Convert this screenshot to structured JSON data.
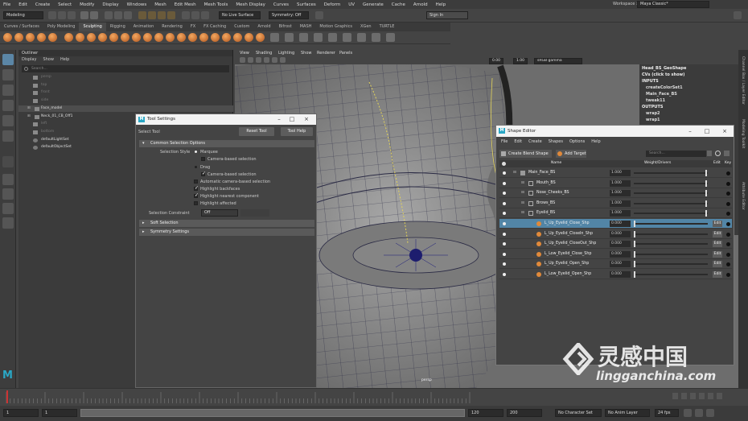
{
  "menubar": {
    "items": [
      "File",
      "Edit",
      "Create",
      "Select",
      "Modify",
      "Display",
      "Windows",
      "Mesh",
      "Edit Mesh",
      "Mesh Tools",
      "Mesh Display",
      "Curves",
      "Surfaces",
      "Deform",
      "UV",
      "Generate",
      "Cache",
      "Arnold",
      "Help"
    ],
    "workspace_label": "Workspace :",
    "workspace_value": "Maya Classic*"
  },
  "statusline": {
    "mode": "Modeling",
    "live_surface": "No Live Surface",
    "symmetry": "Symmetry: Off",
    "sign_in": "Sign In"
  },
  "shelf": {
    "tabs": [
      "Curves / Surfaces",
      "Poly Modeling",
      "Sculpting",
      "Rigging",
      "Animation",
      "Rendering",
      "FX",
      "FX Caching",
      "Custom",
      "Arnold",
      "Bifrost",
      "MASH",
      "Motion Graphics",
      "XGen",
      "TURTLE"
    ],
    "active_tab": "Sculpting"
  },
  "outliner": {
    "title": "Outliner",
    "menu": [
      "Display",
      "Show",
      "Help"
    ],
    "search_placeholder": "Search...",
    "items": [
      {
        "label": "persp",
        "dim": true
      },
      {
        "label": "top",
        "dim": true
      },
      {
        "label": "front",
        "dim": true
      },
      {
        "label": "side",
        "dim": true
      },
      {
        "label": "Face_model",
        "dim": false,
        "selected": true
      },
      {
        "label": "Neck_01_CB_Off1",
        "dim": false
      },
      {
        "label": "left",
        "dim": true
      },
      {
        "label": "bottom",
        "dim": true
      },
      {
        "label": "defaultLightSet",
        "dim": false
      },
      {
        "label": "defaultObjectSet",
        "dim": false
      }
    ]
  },
  "viewport": {
    "menu": [
      "View",
      "Shading",
      "Lighting",
      "Show",
      "Renderer",
      "Panels"
    ],
    "exposure": "0.00",
    "gamma": "1.00",
    "colorspace": "sRGB gamma",
    "camera_label": "persp"
  },
  "channelbox": {
    "menu": [
      "Channels",
      "Edit",
      "Object",
      "Show"
    ],
    "node": "Head_BS_GeoShape",
    "cvs": "CVs (click to show)",
    "inputs_label": "INPUTS",
    "inputs": [
      "createColorSet1",
      "Main_Face_BS",
      "tweak11"
    ],
    "outputs_label": "OUTPUTS",
    "outputs": [
      "wrap2",
      "wrap1"
    ],
    "side_tabs": [
      "Channel Box / Layer Editor",
      "Modeling Toolkit",
      "Attribute Editor"
    ]
  },
  "tool_settings": {
    "title": "Tool Settings",
    "tool_name": "Select Tool",
    "reset_label": "Reset Tool",
    "help_label": "Tool Help",
    "common_section": "Common Selection Options",
    "selection_style_label": "Selection Style",
    "marquee": "Marquee",
    "camera_based_1": "Camera-based selection",
    "drag": "Drag",
    "camera_based_2": "Camera-based selection",
    "auto_camera": "Automatic camera-based selection",
    "highlight_backfaces": "Highlight backfaces",
    "highlight_nearest": "Highlight nearest component",
    "highlight_affected": "Highlight affected",
    "constraint_label": "Selection Constraint",
    "constraint_value": "Off",
    "soft_section": "Soft Selection",
    "symmetry_section": "Symmetry Settings"
  },
  "shape_editor": {
    "title": "Shape Editor",
    "menu": [
      "File",
      "Edit",
      "Create",
      "Shapes",
      "Options",
      "Help"
    ],
    "create_blend": "Create Blend Shape",
    "add_target": "Add Target",
    "search_placeholder": "Search...",
    "col_name": "Name",
    "col_weight": "Weight/Drivers",
    "col_edit": "Edit",
    "col_key": "Key",
    "edit_label": "Edit",
    "rows": [
      {
        "name": "Main_Face_BS",
        "weight": "1.000",
        "type": "blend",
        "indent": 0,
        "edit": false
      },
      {
        "name": "Mouth_BS",
        "weight": "1.000",
        "type": "group",
        "indent": 1,
        "edit": false
      },
      {
        "name": "Nose_Cheeks_BS",
        "weight": "1.000",
        "type": "group",
        "indent": 1,
        "edit": false
      },
      {
        "name": "Brows_BS",
        "weight": "1.000",
        "type": "group",
        "indent": 1,
        "edit": false
      },
      {
        "name": "Eyelid_BS",
        "weight": "1.000",
        "type": "group",
        "indent": 1,
        "edit": false
      },
      {
        "name": "L_Up_Eyelid_Close_Shp",
        "weight": "0.000",
        "type": "target",
        "indent": 2,
        "edit": true,
        "selected": true
      },
      {
        "name": "L_Up_Eyelid_CloseIn_Shp",
        "weight": "0.000",
        "type": "target",
        "indent": 2,
        "edit": true
      },
      {
        "name": "L_Up_Eyelid_CloseOut_Shp",
        "weight": "0.000",
        "type": "target",
        "indent": 2,
        "edit": true
      },
      {
        "name": "L_Low_Eyelid_Close_Shp",
        "weight": "0.000",
        "type": "target",
        "indent": 2,
        "edit": true
      },
      {
        "name": "L_Up_Eyelid_Open_Shp",
        "weight": "0.000",
        "type": "target",
        "indent": 2,
        "edit": true
      },
      {
        "name": "L_Low_Eyelid_Open_Shp",
        "weight": "0.000",
        "type": "target",
        "indent": 2,
        "edit": true
      }
    ]
  },
  "timeline": {
    "start": "1",
    "current": "1",
    "range_start": "1",
    "range_end": "120",
    "anim_end": "200",
    "character_set": "No Character Set",
    "anim_layer": "No Anim Layer",
    "fps": "24 fps"
  },
  "watermark": {
    "cn_text": "灵感中国",
    "url_text": "lingganchina.com"
  },
  "colors": {
    "accent_blue": "#5285a6",
    "maya_blue": "#2aa7c5",
    "target_orange": "#e0893a"
  }
}
